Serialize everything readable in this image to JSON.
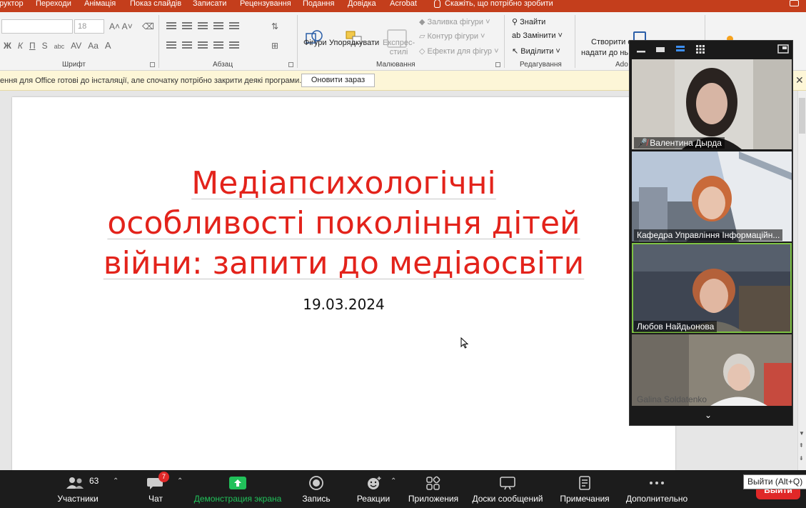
{
  "ribbon_tabs": [
    "руктор",
    "Переходи",
    "Анімація",
    "Показ слайдів",
    "Записати",
    "Рецензування",
    "Подання",
    "Довідка",
    "Acrobat"
  ],
  "tell_me": "Скажіть, що потрібно зробити",
  "font_group": {
    "label": "Шрифт",
    "size_value": "18",
    "font_value": ""
  },
  "paragraph_group": {
    "label": "Абзац"
  },
  "drawing_group": {
    "label": "Малювання",
    "shapes_label": "Фігури",
    "arrange_label": "Упорядкувати",
    "express_label": "Експрес-\nстилі",
    "fill_label": "Заливка фігури",
    "outline_label": "Контур фігури",
    "effects_label": "Ефекти для фігур"
  },
  "editing_group": {
    "label": "Редагування",
    "find": "Знайти",
    "replace": "Замінити",
    "select": "Виділити"
  },
  "adobe_group": {
    "label": "Ado",
    "create_label_1": "Створити с",
    "create_label_2": "надати до нь"
  },
  "infobar": {
    "message": "ення для Office готові до інсталяції, але спочатку потрібно закрити деякі програми.",
    "update_button": "Оновити зараз"
  },
  "slide": {
    "title_lines": [
      "Медіапсихологічні",
      "особливості покоління дітей",
      "війни: запити до медіаосвіти"
    ],
    "date": "19.03.2024"
  },
  "participants": [
    {
      "name": "Валентина Дырда",
      "muted": true
    },
    {
      "name": "Кафедра Управління Інформаційн...",
      "muted": false
    },
    {
      "name": "Любов Найдьонова",
      "muted": false
    },
    {
      "name": "Galina Soldatenko",
      "muted": false
    }
  ],
  "zoom_toolbar": {
    "participants_label": "Участники",
    "participants_count": "63",
    "chat_label": "Чат",
    "chat_badge": "7",
    "share_label": "Демонстрация экрана",
    "record_label": "Запись",
    "reactions_label": "Реакции",
    "apps_label": "Приложения",
    "whiteboards_label": "Доски сообщений",
    "notes_label": "Примечания",
    "more_label": "Дополнительно",
    "end_label": "Выйти",
    "tooltip": "Выйти (Alt+Q)"
  },
  "colors": {
    "ribbon_tabs_bg": "#c43e1c",
    "title_red": "#e3231b",
    "share_green": "#21c15a",
    "end_red": "#e02828"
  }
}
